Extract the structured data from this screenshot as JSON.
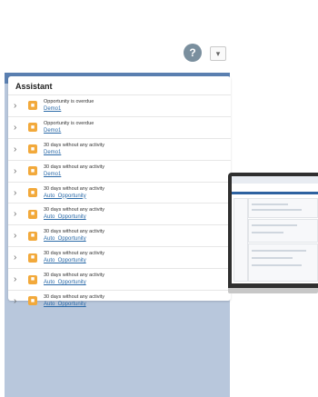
{
  "header": {
    "help_icon": "question-badge-icon",
    "dropdown_label": "▾"
  },
  "assistant": {
    "title": "Assistant",
    "items": [
      {
        "title": "Opportunity is overdue",
        "link": "Demo1"
      },
      {
        "title": "Opportunity is overdue",
        "link": "Demo1"
      },
      {
        "title": "30 days without any activity",
        "link": "Demo1"
      },
      {
        "title": "30 days without any activity",
        "link": "Demo1"
      },
      {
        "title": "30 days without any activity",
        "link": "Auto_Opportunity"
      },
      {
        "title": "30 days without any activity",
        "link": "Auto_Opportunity"
      },
      {
        "title": "30 days without any activity",
        "link": "Auto_Opportunity"
      },
      {
        "title": "30 days without any activity",
        "link": "Auto_Opportunity"
      },
      {
        "title": "30 days without any activity",
        "link": "Auto_Opportunity"
      },
      {
        "title": "30 days without any activity",
        "link": "Auto_Opportunity"
      }
    ]
  },
  "colors": {
    "accent": "#2b6aa8",
    "item_icon": "#f2a93b",
    "panel_bg": "#b8c7dc"
  }
}
